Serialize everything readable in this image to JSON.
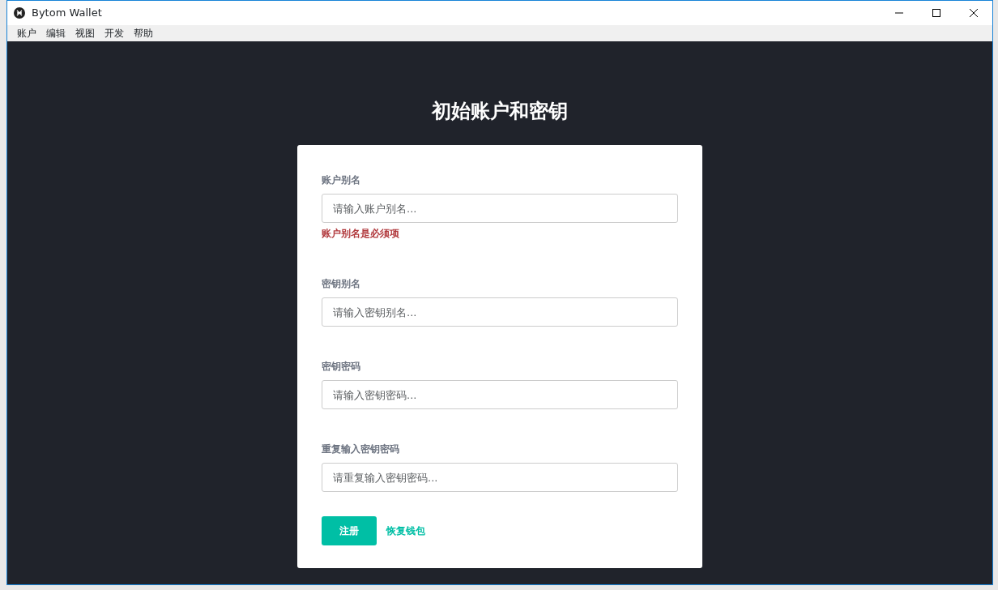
{
  "window": {
    "title": "Bytom Wallet"
  },
  "menu": [
    "账户",
    "编辑",
    "视图",
    "开发",
    "帮助"
  ],
  "heading": "初始账户和密钥",
  "fields": [
    {
      "label": "账户别名",
      "placeholder": "请输入账户别名...",
      "error": "账户别名是必须项"
    },
    {
      "label": "密钥别名",
      "placeholder": "请输入密钥别名..."
    },
    {
      "label": "密钥密码",
      "placeholder": "请输入密钥密码..."
    },
    {
      "label": "重复输入密钥密码",
      "placeholder": "请重复输入密钥密码..."
    }
  ],
  "submit_button": "注册",
  "restore_link": "恢复钱包"
}
